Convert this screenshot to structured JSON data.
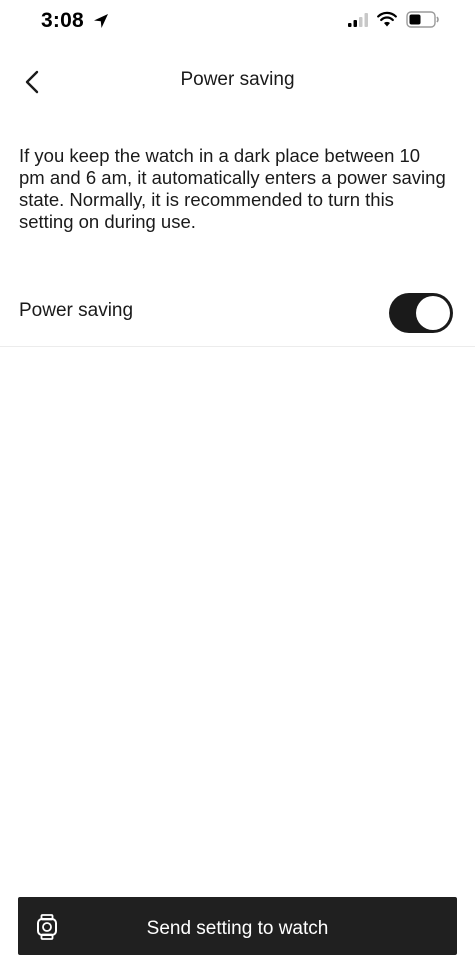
{
  "status_bar": {
    "time": "3:08",
    "icons": [
      "location-arrow-icon",
      "cellular-signal-icon",
      "wifi-icon",
      "battery-icon"
    ]
  },
  "header": {
    "back_icon": "chevron-left-icon",
    "title": "Power saving"
  },
  "description": "If you keep the watch in a dark place between 10 pm and 6 am, it automatically enters a power saving state. Normally, it is recommended to turn this setting on during use.",
  "settings": {
    "power_saving": {
      "label": "Power saving",
      "enabled": true
    }
  },
  "footer": {
    "button_icon": "watch-icon",
    "button_label": "Send setting to watch"
  },
  "colors": {
    "accent": "#1a1a1a",
    "button_background": "#202020",
    "background": "#ffffff"
  }
}
